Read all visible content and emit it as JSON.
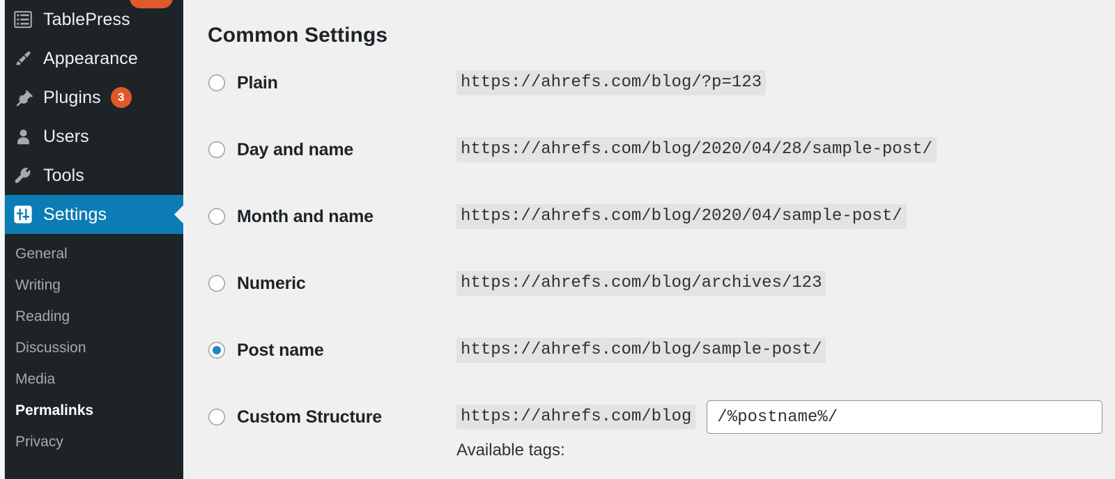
{
  "sidebar": {
    "menu": [
      {
        "label": "TablePress",
        "icon": "table-list-icon",
        "badge": null
      },
      {
        "label": "Appearance",
        "icon": "paintbrush-icon",
        "badge": null
      },
      {
        "label": "Plugins",
        "icon": "plug-icon",
        "badge": "3"
      },
      {
        "label": "Users",
        "icon": "user-icon",
        "badge": null
      },
      {
        "label": "Tools",
        "icon": "wrench-icon",
        "badge": null
      },
      {
        "label": "Settings",
        "icon": "sliders-icon",
        "badge": null
      }
    ],
    "submenu": [
      {
        "label": "General"
      },
      {
        "label": "Writing"
      },
      {
        "label": "Reading"
      },
      {
        "label": "Discussion"
      },
      {
        "label": "Media"
      },
      {
        "label": "Permalinks"
      },
      {
        "label": "Privacy"
      }
    ],
    "current_menu": "Settings",
    "current_submenu": "Permalinks",
    "colors": {
      "background": "#1d2327",
      "current_highlight": "#0c7cb5",
      "badge": "#e0592a",
      "label": "#f0f0f1",
      "submenu_label": "#a7aaad"
    }
  },
  "main": {
    "heading": "Common Settings",
    "options": [
      {
        "label": "Plain",
        "url": "https://ahrefs.com/blog/?p=123",
        "selected": false
      },
      {
        "label": "Day and name",
        "url": "https://ahrefs.com/blog/2020/04/28/sample-post/",
        "selected": false
      },
      {
        "label": "Month and name",
        "url": "https://ahrefs.com/blog/2020/04/sample-post/",
        "selected": false
      },
      {
        "label": "Numeric",
        "url": "https://ahrefs.com/blog/archives/123",
        "selected": false
      },
      {
        "label": "Post name",
        "url": "https://ahrefs.com/blog/sample-post/",
        "selected": true
      },
      {
        "label": "Custom Structure",
        "url": "https://ahrefs.com/blog",
        "selected": false
      }
    ],
    "custom_structure": {
      "value": "/%postname%/",
      "placeholder": ""
    },
    "available_tags_label": "Available tags:",
    "colors": {
      "background": "#f0f0f1",
      "code_background": "#e3e3e3",
      "text": "#1d2327",
      "accent": "#1c87c8"
    }
  }
}
